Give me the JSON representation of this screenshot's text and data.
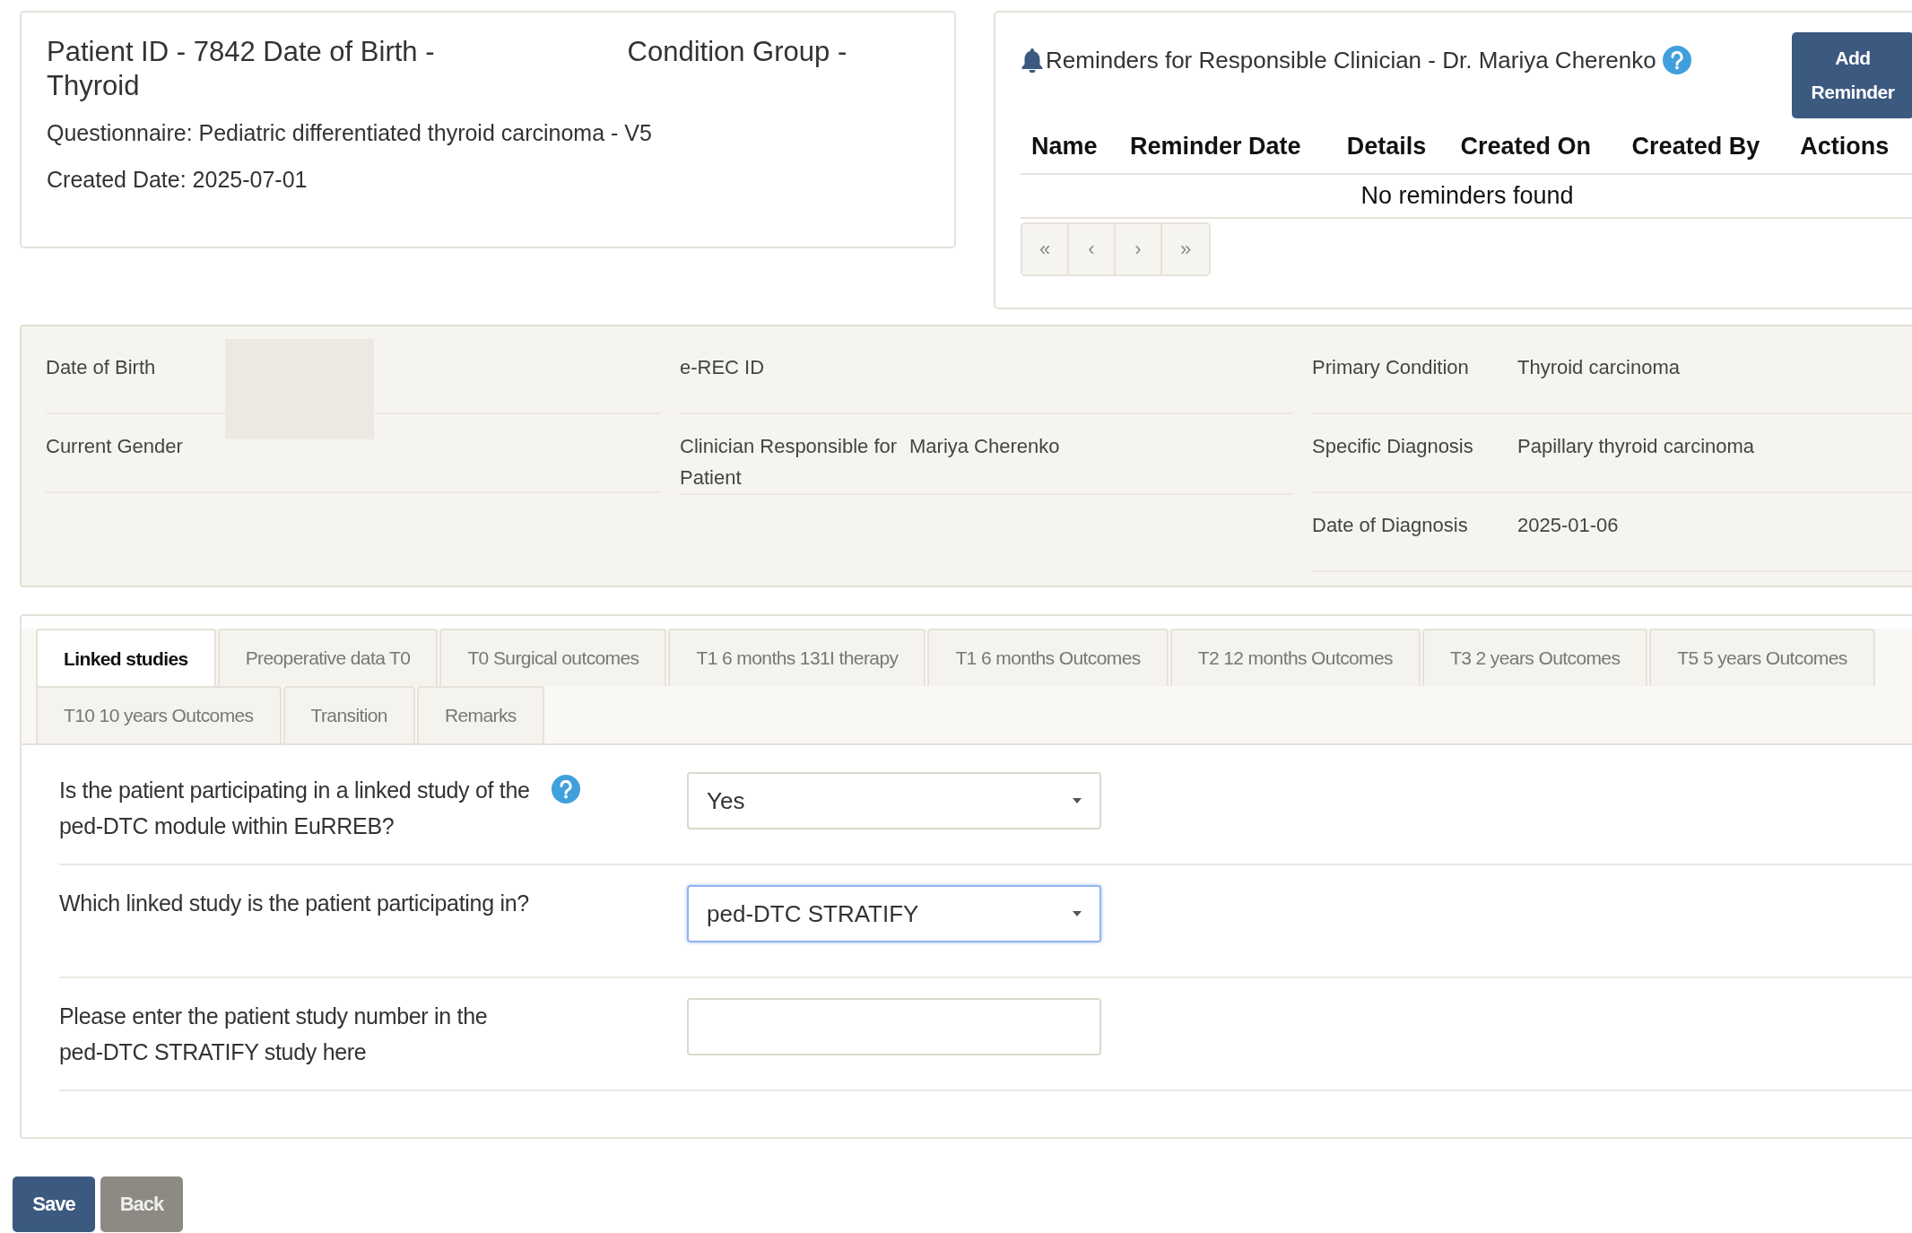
{
  "summary": {
    "patient_id": "Patient ID - 7842",
    "date_of_birth": "Date of Birth -",
    "condition_group": "Condition Group -",
    "condition_group_value": "Thyroid",
    "questionnaire": "Questionnaire: Pediatric differentiated thyroid carcinoma - V5",
    "created_date": "Created Date: 2025-07-01"
  },
  "reminders": {
    "title": "Reminders for Responsible Clinician - Dr. Mariya Cherenko",
    "add_button": "Add Reminder",
    "columns": [
      "Name",
      "Reminder Date",
      "Details",
      "Created On",
      "Created By",
      "Actions"
    ],
    "empty_message": "No reminders found",
    "pager": [
      {
        "label": "«",
        "disabled": true
      },
      {
        "label": "‹",
        "disabled": true
      },
      {
        "label": "›",
        "disabled": true
      },
      {
        "label": "»",
        "disabled": true
      }
    ]
  },
  "patient_info": {
    "columns": [
      {
        "rows": [
          {
            "label": "Date of Birth",
            "redacted": true
          },
          {
            "label": "Current Gender"
          }
        ]
      },
      {
        "rows": [
          {
            "label": "e-REC ID"
          },
          {
            "label": "Clinician Responsible for Patient",
            "value": "Mariya Cherenko"
          }
        ]
      },
      {
        "rows": [
          {
            "label": "Primary Condition",
            "value": "Thyroid carcinoma"
          },
          {
            "label": "Specific Diagnosis",
            "value": "Papillary thyroid carcinoma"
          },
          {
            "label": "Date of Diagnosis",
            "value": "2025-01-06"
          }
        ]
      }
    ]
  },
  "tabs": [
    {
      "label": "Linked studies",
      "selected": true
    },
    {
      "label": "Preoperative data T0",
      "selected": false
    },
    {
      "label": "T0 Surgical outcomes",
      "selected": false
    },
    {
      "label": "T1 6 months 131I therapy",
      "selected": false
    },
    {
      "label": "T1 6 months Outcomes",
      "selected": false
    },
    {
      "label": "T2 12 months Outcomes",
      "selected": false
    },
    {
      "label": "T3 2 years Outcomes",
      "selected": false
    },
    {
      "label": "T5 5 years Outcomes",
      "selected": false
    },
    {
      "label": "T10 10 years Outcomes",
      "selected": false
    },
    {
      "label": "Transition",
      "selected": false
    },
    {
      "label": "Remarks",
      "selected": false
    }
  ],
  "form": [
    {
      "kind": "select",
      "label": "Is the patient participating in a linked study of the ped-DTC module within EuRREB?",
      "help": true,
      "value": "Yes",
      "focused": false
    },
    {
      "kind": "select",
      "label": "Which linked study is the patient participating in?",
      "help": false,
      "value": "ped-DTC STRATIFY",
      "focused": true
    },
    {
      "kind": "text",
      "label": "Please enter the patient study number in the ped-DTC STRATIFY study here",
      "help": false,
      "focused": false
    }
  ],
  "actions": [
    {
      "label": "Save",
      "kind": "primary"
    },
    {
      "label": "Back",
      "kind": "secondary"
    }
  ]
}
